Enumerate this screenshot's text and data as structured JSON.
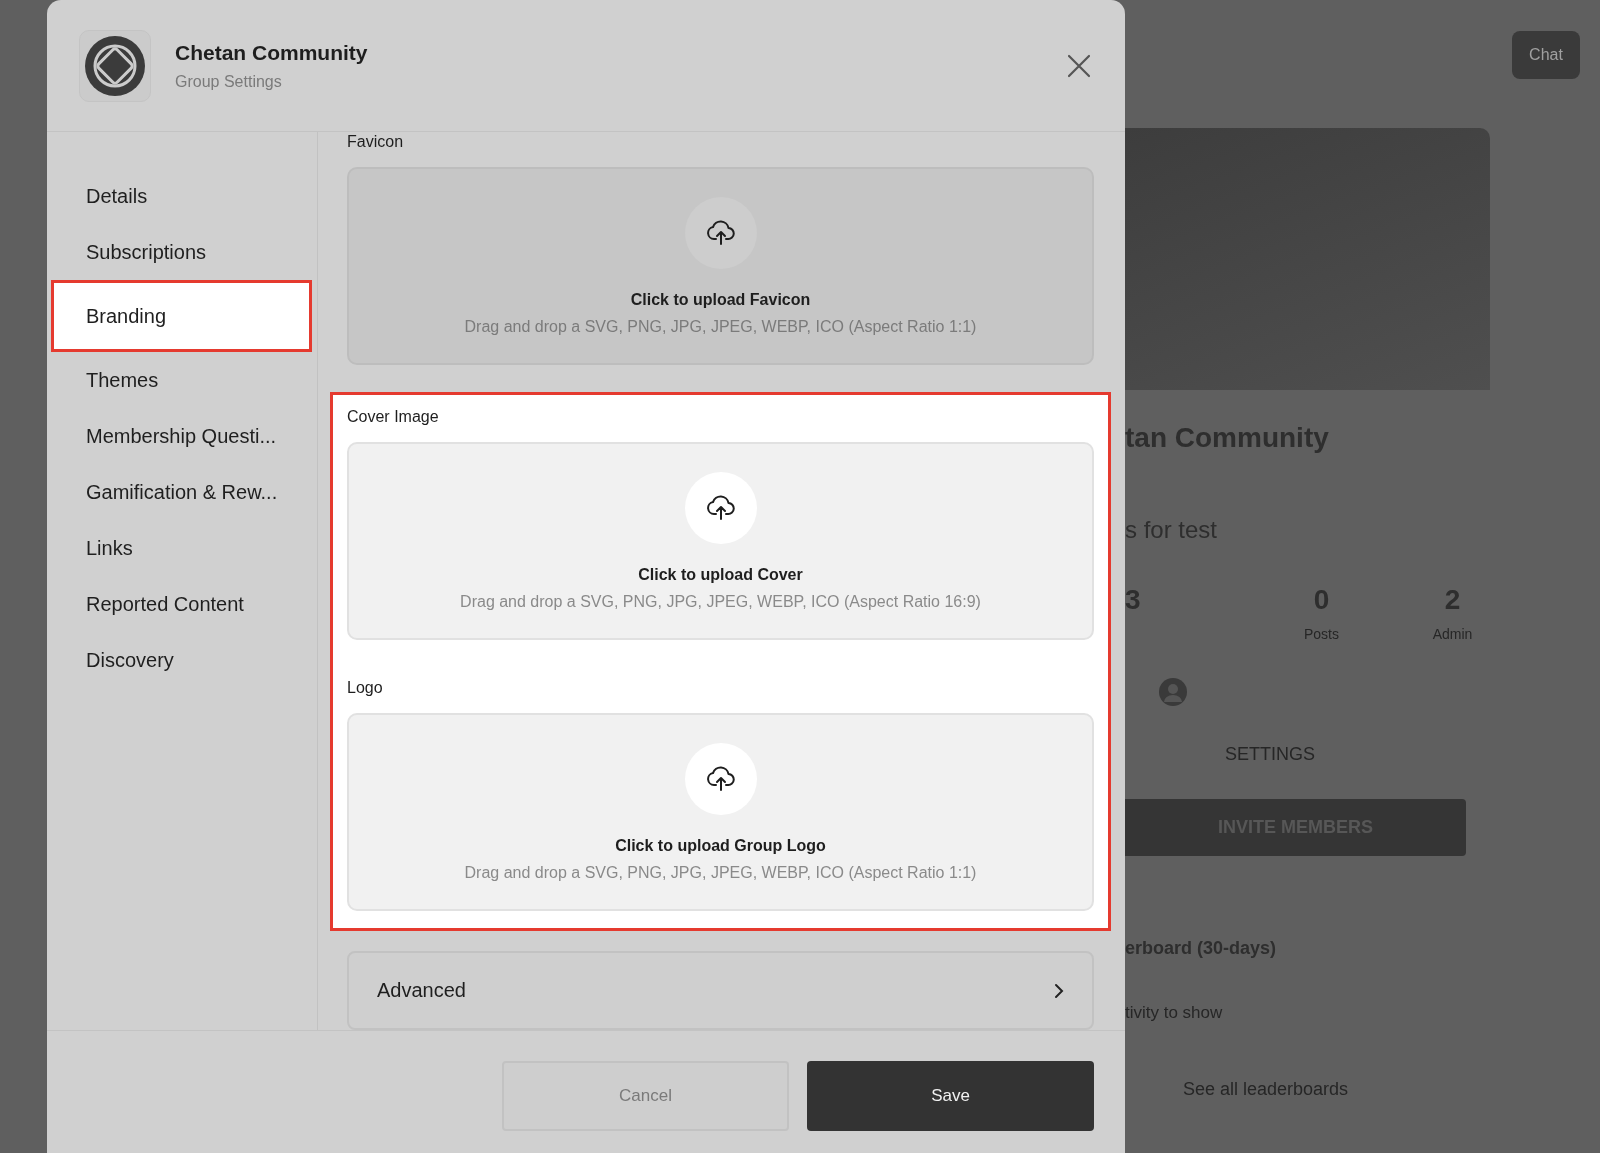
{
  "header": {
    "title": "Chetan Community",
    "subtitle": "Group Settings"
  },
  "nav": [
    {
      "label": "Details",
      "selected": false
    },
    {
      "label": "Subscriptions",
      "selected": false
    },
    {
      "label": "Branding",
      "selected": true
    },
    {
      "label": "Themes",
      "selected": false
    },
    {
      "label": "Membership Questi...",
      "selected": false
    },
    {
      "label": "Gamification & Rew...",
      "selected": false
    },
    {
      "label": "Links",
      "selected": false
    },
    {
      "label": "Reported Content",
      "selected": false
    },
    {
      "label": "Discovery",
      "selected": false
    }
  ],
  "uploads": [
    {
      "label": "Favicon",
      "title": "Click to upload Favicon",
      "hint": "Drag and drop a SVG, PNG, JPG, JPEG, WEBP, ICO (Aspect Ratio 1:1)",
      "highlighted": false
    },
    {
      "label": "Cover Image",
      "title": "Click to upload Cover",
      "hint": "Drag and drop a SVG, PNG, JPG, JPEG, WEBP, ICO (Aspect Ratio 16:9)",
      "highlighted": true
    },
    {
      "label": "Logo",
      "title": "Click to upload Group Logo",
      "hint": "Drag and drop a SVG, PNG, JPG, JPEG, WEBP, ICO (Aspect Ratio 1:1)",
      "highlighted": true
    }
  ],
  "advanced": {
    "label": "Advanced"
  },
  "footer": {
    "buttons": [
      {
        "label": "Cancel",
        "kind": "secondary"
      },
      {
        "label": "Save",
        "kind": "primary"
      }
    ]
  },
  "background": {
    "chat_button": "Chat",
    "group_name": "tan Community",
    "description": "s for test",
    "stats": [
      {
        "value": "3"
      },
      {
        "value": "0",
        "label": "Posts"
      },
      {
        "value": "2",
        "label": "Admin"
      }
    ],
    "settings_label": "SETTINGS",
    "invite_button": "INVITE MEMBERS",
    "leaderboard_title": "erboard (30-days)",
    "leaderboard_empty": "tivity to show",
    "leaderboard_link": "See all leaderboards"
  }
}
